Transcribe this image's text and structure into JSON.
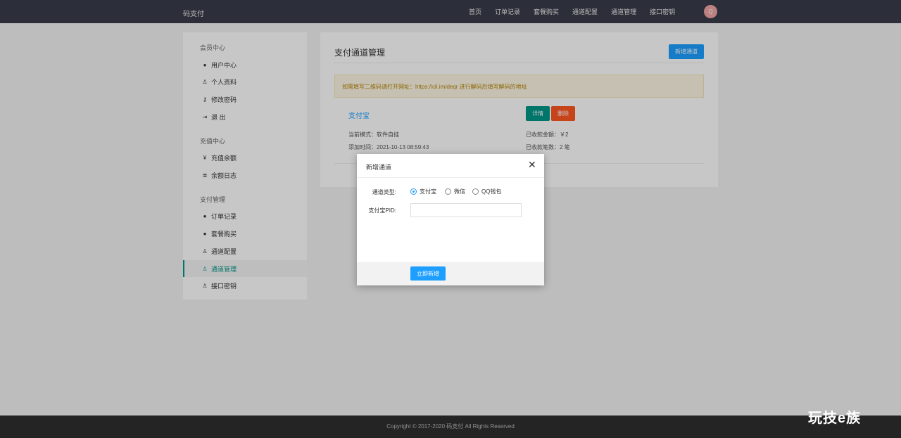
{
  "brand": "码支付",
  "nav": [
    "首页",
    "订单记录",
    "套餐购买",
    "通道配置",
    "通道管理",
    "接口密钥"
  ],
  "avatar_letter": "Q",
  "sidebar": {
    "groups": [
      {
        "title": "会员中心",
        "items": [
          {
            "label": "用户中心",
            "icon": "user-circle-icon"
          },
          {
            "label": "个人资料",
            "icon": "lock-icon"
          },
          {
            "label": "修改密码",
            "icon": "key-icon"
          },
          {
            "label": "退 出",
            "icon": "logout-icon"
          }
        ]
      },
      {
        "title": "充值中心",
        "items": [
          {
            "label": "充值余额",
            "icon": "yen-icon"
          },
          {
            "label": "余额日志",
            "icon": "list-icon"
          }
        ]
      },
      {
        "title": "支付管理",
        "items": [
          {
            "label": "订单记录",
            "icon": "user-circle-icon"
          },
          {
            "label": "套餐购买",
            "icon": "user-circle-icon"
          },
          {
            "label": "通道配置",
            "icon": "lock-icon"
          },
          {
            "label": "通道管理",
            "icon": "lock-icon",
            "active": true
          },
          {
            "label": "接口密钥",
            "icon": "lock-icon"
          }
        ]
      }
    ]
  },
  "main": {
    "title": "支付通道管理",
    "new_button": "新增通道",
    "notice": "如需填写二维码请打开网址：https://cli.im/deqr 进行解码后填写解码的地址",
    "channel": {
      "name": "支付宝",
      "detail_button": "详情",
      "delete_button": "删除",
      "mode": "当前模式：软件自挂",
      "added": "添加时间：2021-10-13 08:59:43",
      "amount": "已收款金额：￥2",
      "count": "已收款笔数：2 笔"
    }
  },
  "modal": {
    "title": "新增通道",
    "type_label": "通道类型:",
    "options": [
      "支付宝",
      "微信",
      "QQ钱包"
    ],
    "selected": "支付宝",
    "pid_label": "支付宝PID:",
    "pid_value": "",
    "submit": "立即新增"
  },
  "footer": "Copyright © 2017-2020 码支付 All Rights Reserved",
  "watermark": "玩技e族",
  "colors": {
    "primary": "#1e9fff",
    "green": "#009688",
    "danger": "#ff5722",
    "topbar": "#393d49"
  }
}
